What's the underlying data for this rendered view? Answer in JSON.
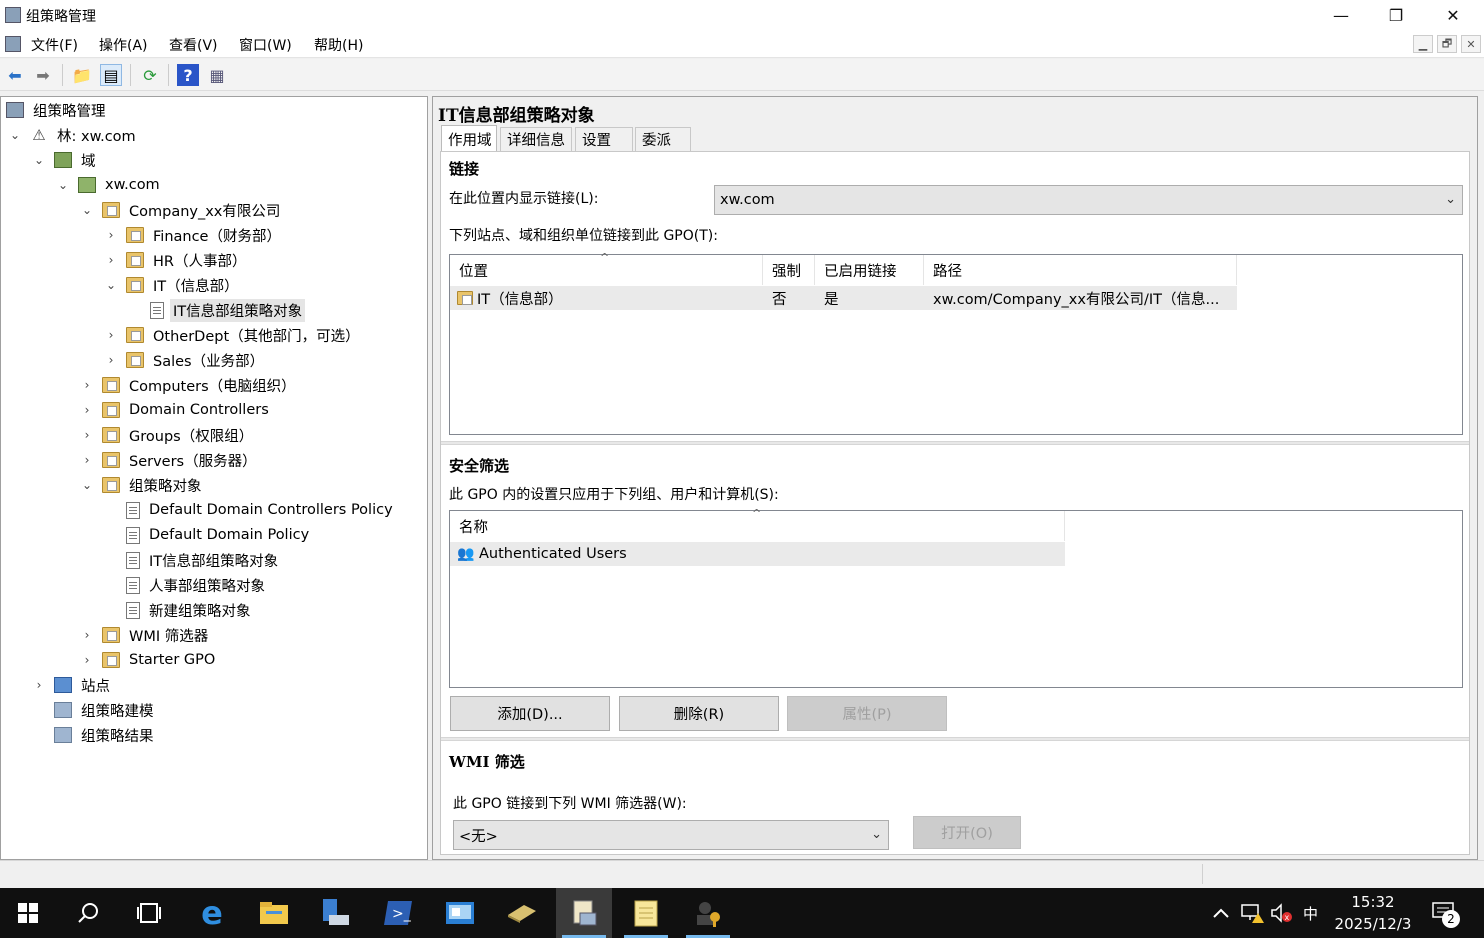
{
  "window": {
    "title": "组策略管理",
    "minimize": "—",
    "maximize": "❐",
    "close": "✕"
  },
  "menu": [
    "文件(F)",
    "操作(A)",
    "查看(V)",
    "窗口(W)",
    "帮助(H)"
  ],
  "mdi": {
    "min": "▁",
    "restore": "🗗",
    "close": "✕"
  },
  "toolbar": {
    "back": "back-arrow-icon",
    "forward": "forward-arrow-icon",
    "up": "folder-up-icon",
    "showhide": "console-tree-icon",
    "refresh": "refresh-icon",
    "help": "help-icon",
    "view": "view-icon"
  },
  "tree": {
    "root": "组策略管理",
    "forest": "林: xw.com",
    "domains": "域",
    "domain": "xw.com",
    "company": "Company_xx有限公司",
    "finance": "Finance（财务部）",
    "hr": "HR（人事部）",
    "it": "IT（信息部）",
    "it_gpo": "IT信息部组策略对象",
    "other": "OtherDept（其他部门，可选）",
    "sales": "Sales（业务部）",
    "computers": "Computers（电脑组织）",
    "dcs": "Domain Controllers",
    "groups": "Groups（权限组）",
    "servers": "Servers（服务器）",
    "gpos": "组策略对象",
    "gpo_ddcp": "Default Domain Controllers Policy",
    "gpo_ddp": "Default Domain Policy",
    "gpo_it": "IT信息部组策略对象",
    "gpo_hr": "人事部组策略对象",
    "gpo_new": "新建组策略对象",
    "wmi": "WMI 筛选器",
    "starter": "Starter GPO",
    "sites": "站点",
    "modeling": "组策略建模",
    "results": "组策略结果"
  },
  "detail": {
    "title": "IT信息部组策略对象",
    "tabs": [
      "作用域",
      "详细信息",
      "设置",
      "委派"
    ],
    "links": {
      "heading": "链接",
      "location_label": "在此位置内显示链接(L):",
      "location_value": "xw.com",
      "list_label": "下列站点、域和组织单位链接到此 GPO(T):",
      "columns": [
        "位置",
        "强制",
        "已启用链接",
        "路径"
      ],
      "rows": [
        {
          "location": "IT（信息部）",
          "enforced": "否",
          "enabled": "是",
          "path": "xw.com/Company_xx有限公司/IT（信息..."
        }
      ]
    },
    "security": {
      "heading": "安全筛选",
      "label": "此 GPO 内的设置只应用于下列组、用户和计算机(S):",
      "column": "名称",
      "rows": [
        "Authenticated Users"
      ],
      "add": "添加(D)...",
      "remove": "删除(R)",
      "properties": "属性(P)"
    },
    "wmi": {
      "heading": "WMI 筛选",
      "label": "此 GPO 链接到下列 WMI 筛选器(W):",
      "value": "<无>",
      "open": "打开(O)"
    }
  },
  "taskbar": {
    "apps": [
      "start-icon",
      "search-icon",
      "task-view-icon",
      "edge-icon",
      "file-explorer-icon",
      "server-manager-icon",
      "powershell-icon",
      "control-panel-icon",
      "toolbox-icon",
      "group-policy-icon",
      "notepad-icon",
      "ad-users-icon"
    ],
    "ime": "中",
    "time": "15:32",
    "date": "2025/12/3",
    "notifications": "2"
  }
}
